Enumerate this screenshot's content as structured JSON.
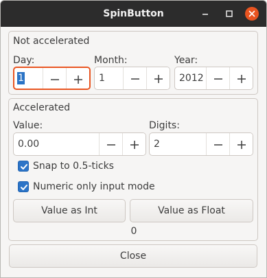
{
  "window": {
    "title": "SpinButton",
    "accent_color": "#e95420"
  },
  "not_accelerated": {
    "label": "Not accelerated",
    "day": {
      "label": "Day:",
      "value": "1"
    },
    "month": {
      "label": "Month:",
      "value": "1"
    },
    "year": {
      "label": "Year:",
      "value": "2012"
    }
  },
  "accelerated": {
    "label": "Accelerated",
    "value": {
      "label": "Value:",
      "value": "0.00"
    },
    "digits": {
      "label": "Digits:",
      "value": "2"
    },
    "snap_checkbox": {
      "label": "Snap to 0.5-ticks",
      "checked": true
    },
    "numeric_checkbox": {
      "label": "Numeric only input mode",
      "checked": true
    },
    "value_as_int_label": "Value as Int",
    "value_as_float_label": "Value as Float",
    "result": "0"
  },
  "close_label": "Close",
  "icons": {
    "decrement": "minus-icon",
    "increment": "plus-icon",
    "window_minimize": "minimize-icon",
    "window_maximize": "maximize-icon",
    "window_close": "close-icon",
    "checkbox": "checkmark-icon"
  }
}
